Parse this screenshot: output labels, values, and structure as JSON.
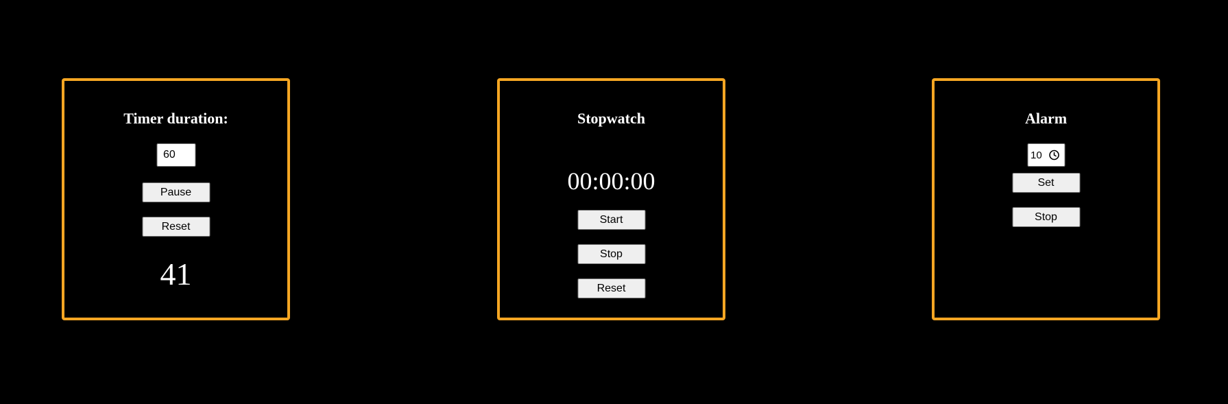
{
  "timer": {
    "heading": "Timer duration:",
    "duration_value": "60",
    "pause_label": "Pause",
    "reset_label": "Reset",
    "remaining": "41"
  },
  "stopwatch": {
    "heading": "Stopwatch",
    "display": "00:00:00",
    "start_label": "Start",
    "stop_label": "Stop",
    "reset_label": "Reset"
  },
  "alarm": {
    "heading": "Alarm",
    "time_value": "10",
    "time_icon": "clock-icon",
    "set_label": "Set",
    "stop_label": "Stop"
  },
  "colors": {
    "background": "#000000",
    "panel_border": "#f5a623",
    "text": "#ffffff",
    "button_bg": "#efefef"
  }
}
